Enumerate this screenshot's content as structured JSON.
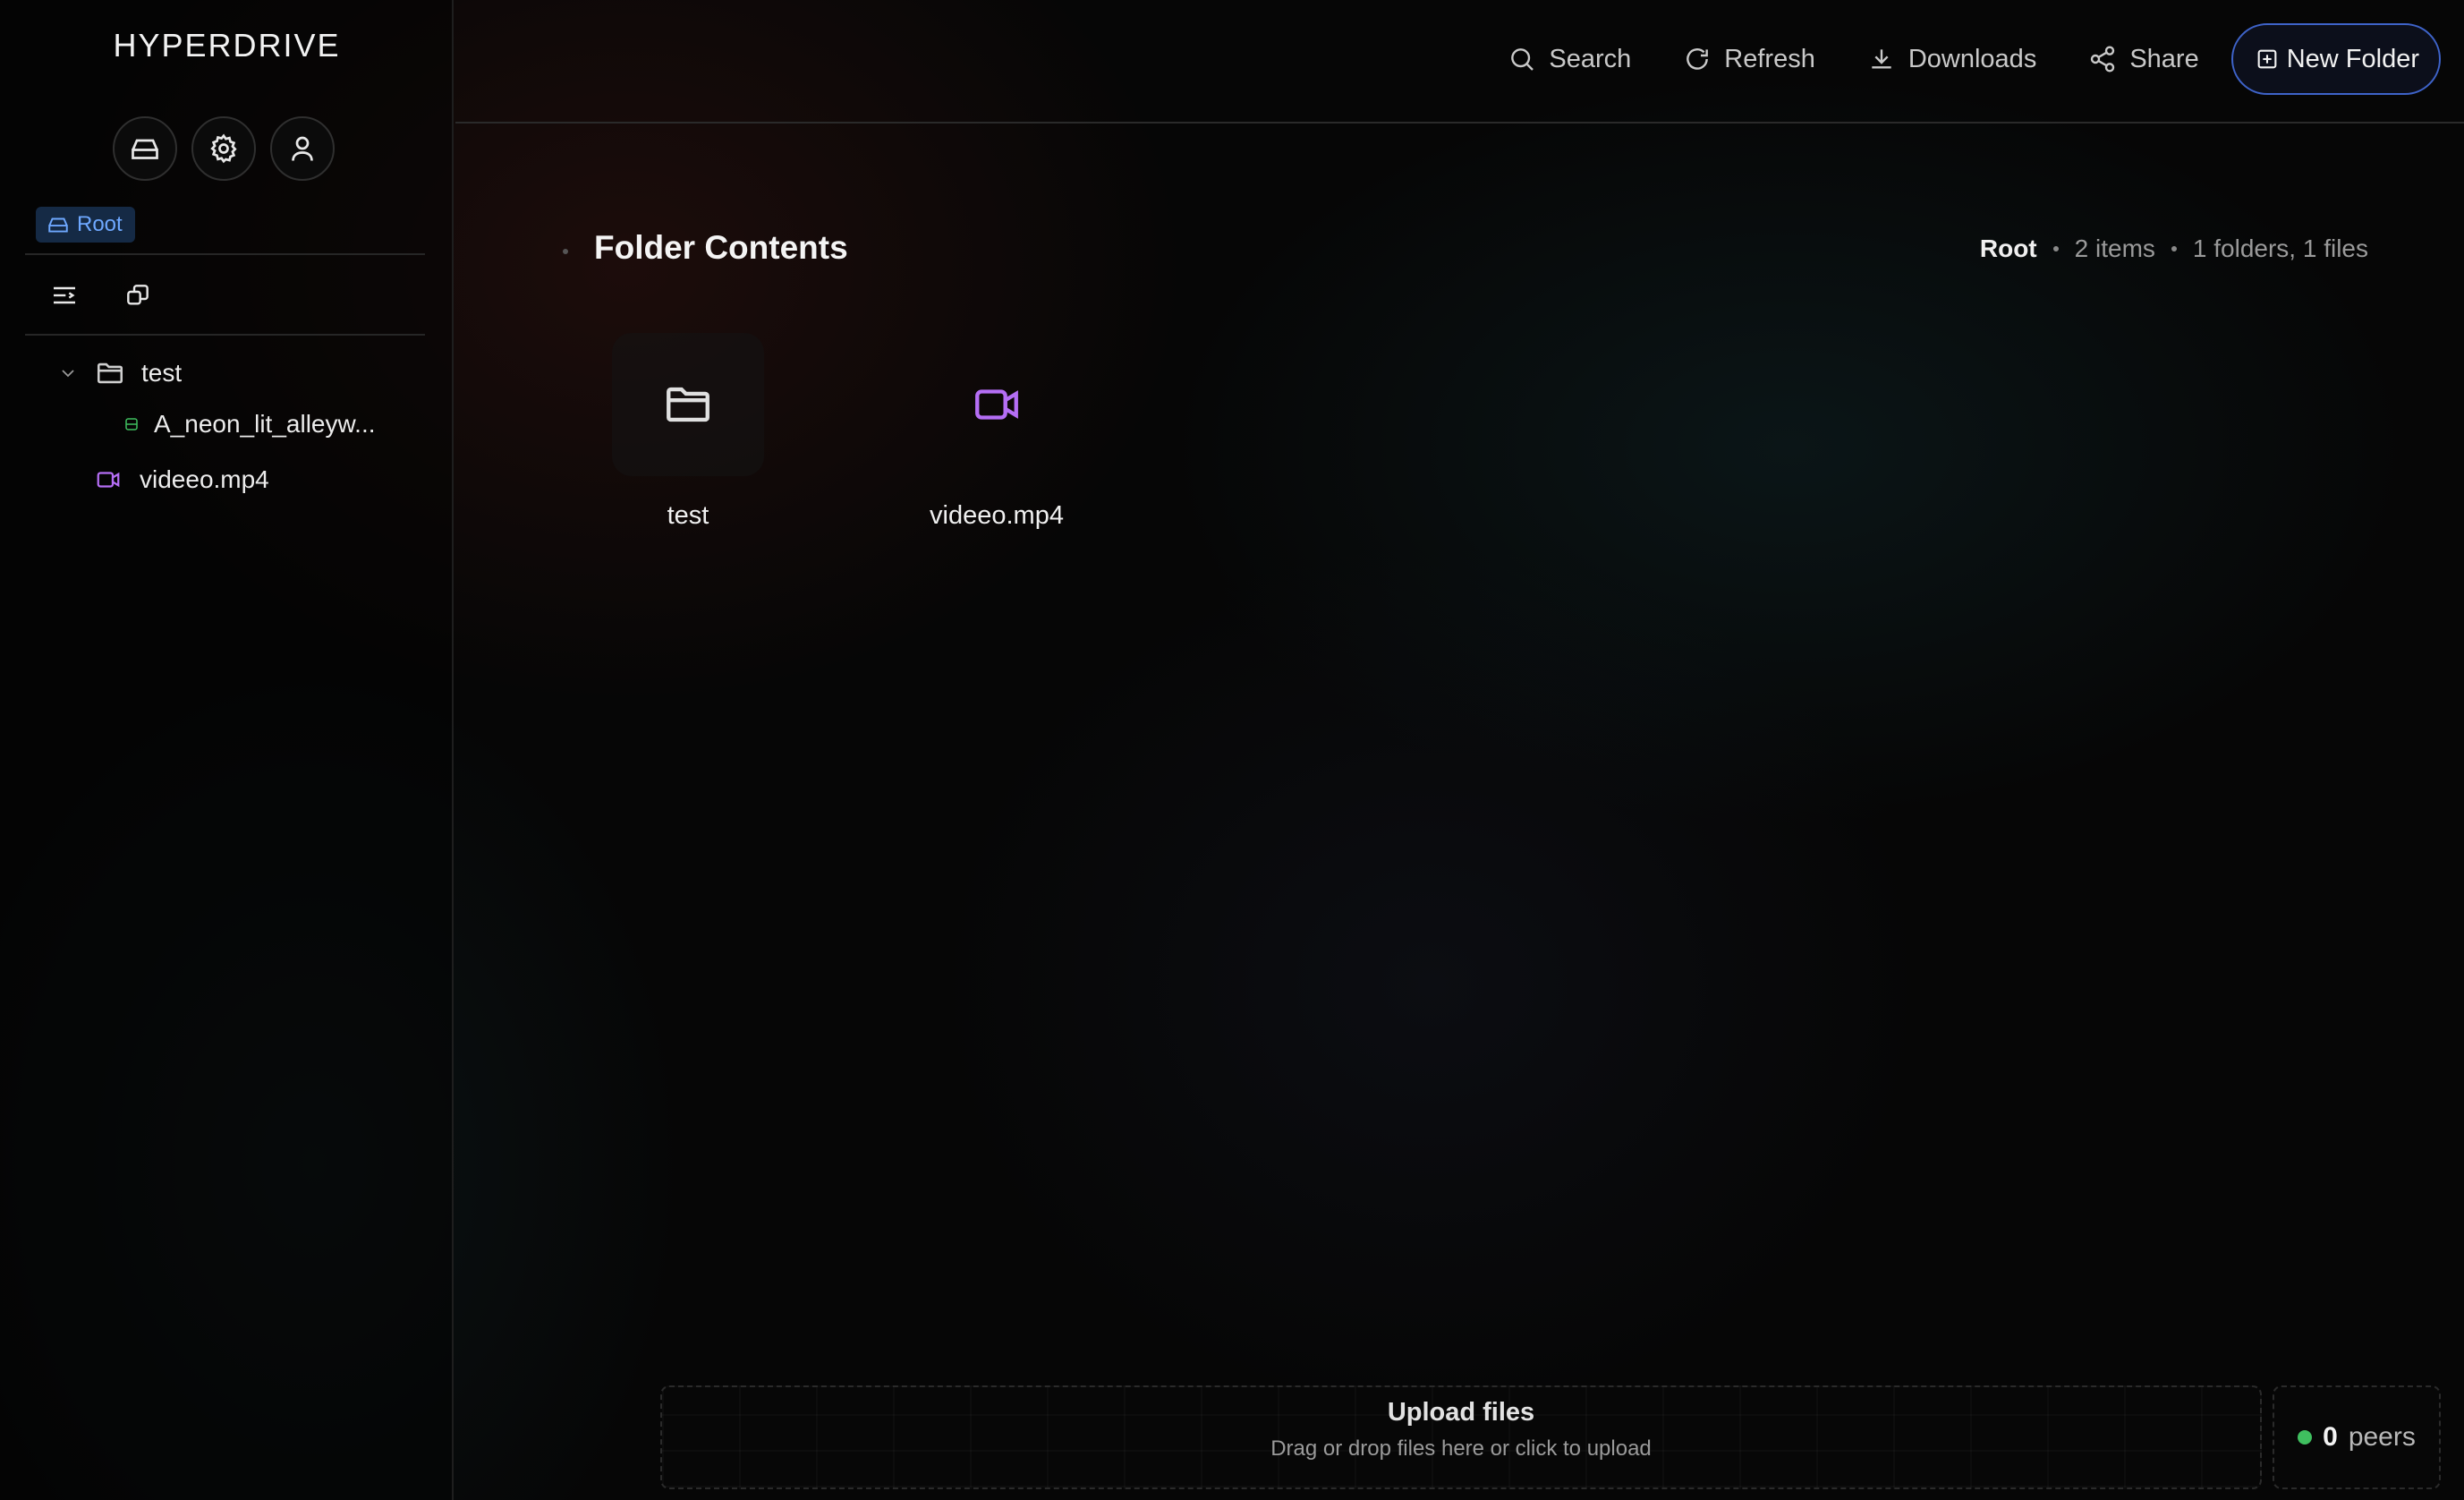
{
  "brand": "HYPERDRIVE",
  "sidebar": {
    "icon_buttons": [
      "drive-icon",
      "gear-icon",
      "user-icon"
    ],
    "root_badge": "Root",
    "tools": [
      "list-collapse-icon",
      "copy-icon"
    ],
    "tree": [
      {
        "label": "test",
        "type": "folder",
        "expanded": true
      },
      {
        "label": "A_neon_lit_alleyw...",
        "type": "image",
        "color": "#3fbf5f"
      },
      {
        "label": "videeo.mp4",
        "type": "video",
        "color": "#b56ef5"
      }
    ]
  },
  "toolbar": {
    "search": "Search",
    "refresh": "Refresh",
    "downloads": "Downloads",
    "share": "Share",
    "new_folder": "New Folder"
  },
  "main": {
    "title": "Folder Contents",
    "meta_root": "Root",
    "meta_items": "2 items",
    "meta_counts": "1 folders, 1 files",
    "items": [
      {
        "label": "test",
        "type": "folder"
      },
      {
        "label": "videeo.mp4",
        "type": "video",
        "color": "#b56ef5"
      }
    ]
  },
  "upload": {
    "title": "Upload files",
    "subtitle": "Drag or drop files here or click to upload"
  },
  "peers": {
    "count": "0",
    "label": "peers",
    "status_color": "#3fbf5f"
  }
}
